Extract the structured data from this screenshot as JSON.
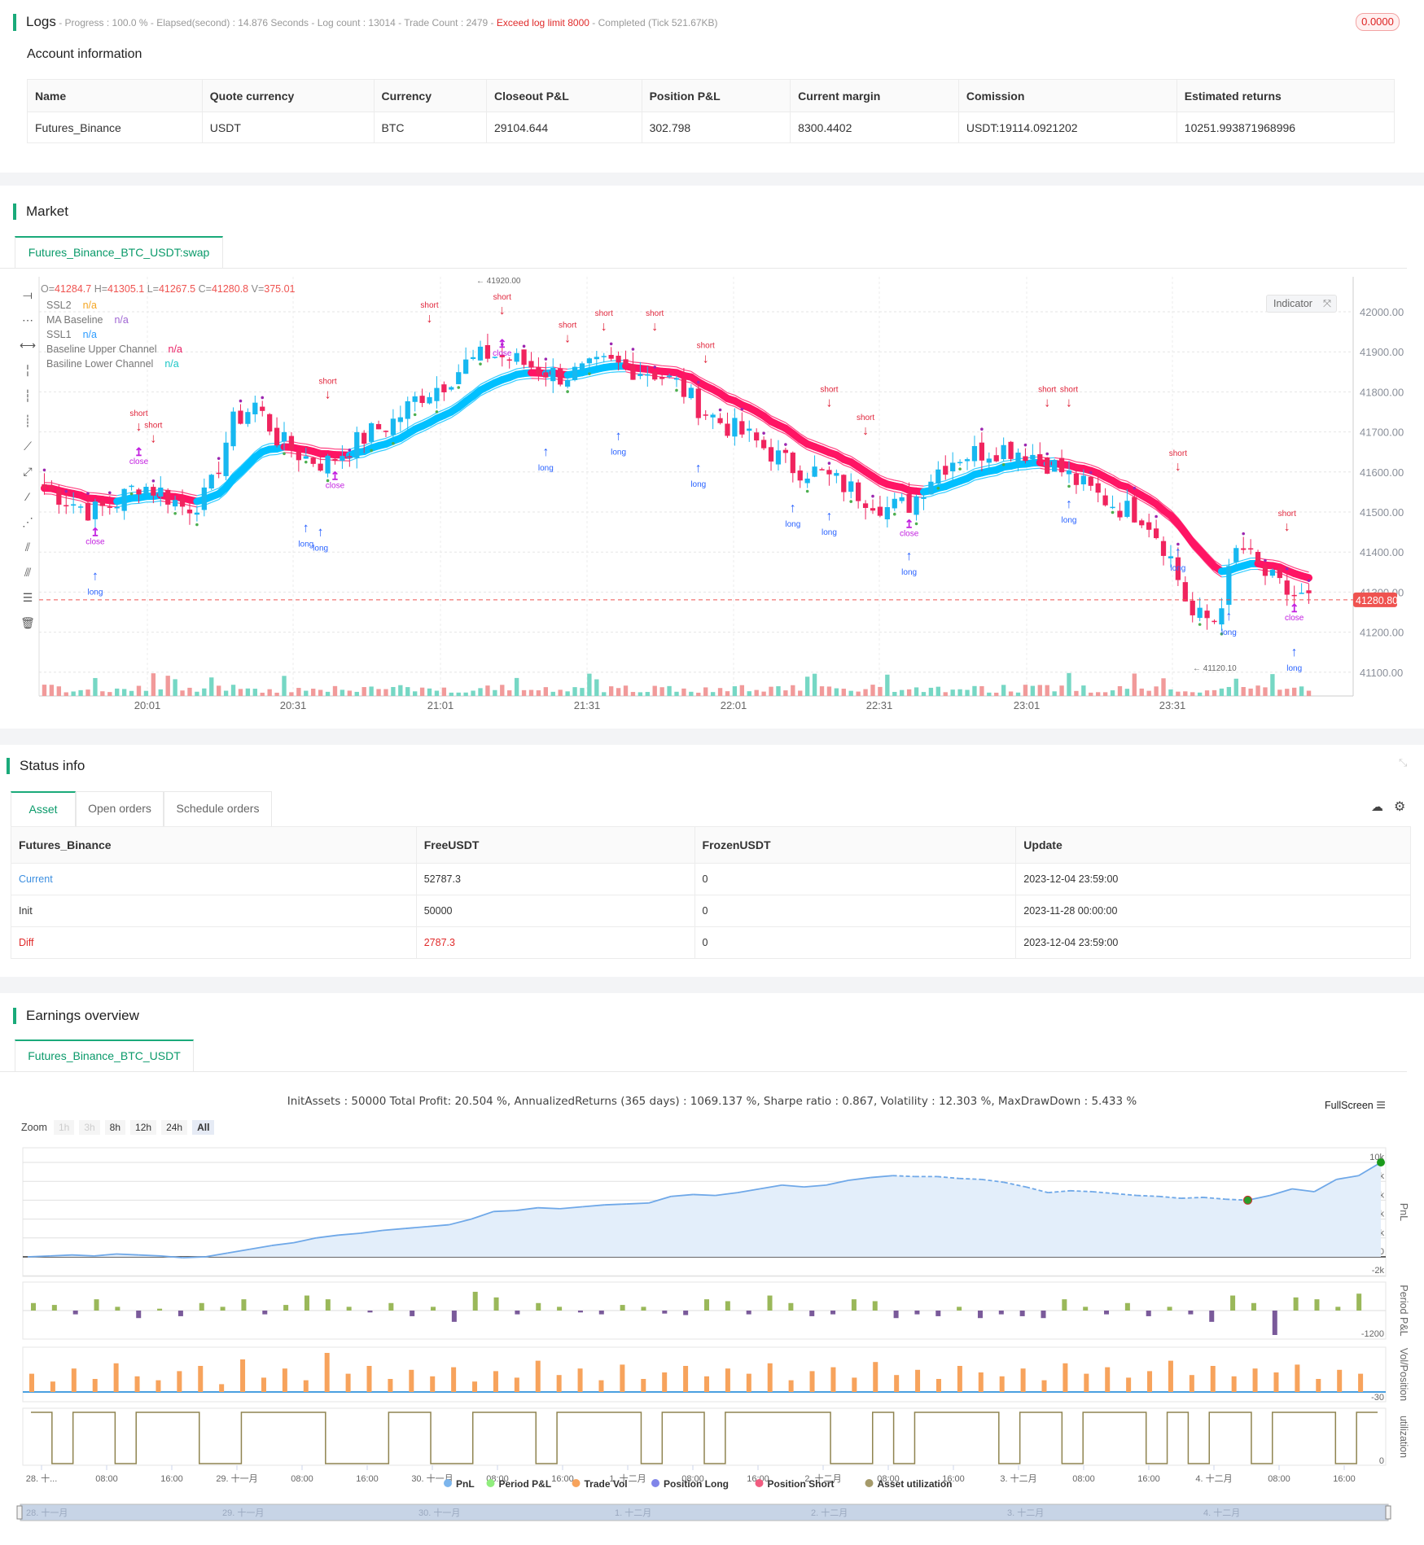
{
  "logs": {
    "title": "Logs",
    "status_prefix": " - Progress : 100.0 % - Elapsed(second) : 14.876 Seconds - Log count : 13014 - Trade Count : 2479 - ",
    "status_warning": "Exceed log limit 8000",
    "status_suffix": " - Completed (Tick 521.67KB)",
    "badge": "0.0000"
  },
  "account": {
    "title": "Account information",
    "columns": [
      "Name",
      "Quote currency",
      "Currency",
      "Closeout P&L",
      "Position P&L",
      "Current margin",
      "Comission",
      "Estimated returns"
    ],
    "row": [
      "Futures_Binance",
      "USDT",
      "BTC",
      "29104.644",
      "302.798",
      "8300.4402",
      "USDT:19114.0921202",
      "10251.993871968996"
    ]
  },
  "market": {
    "title": "Market",
    "tab": "Futures_Binance_BTC_USDT:swap",
    "ohlc": {
      "o_label": "O=",
      "o": "41284.7",
      "h_label": " H=",
      "h": "41305.1",
      "l_label": " L=",
      "l": "41267.5",
      "c_label": " C=",
      "c": "41280.8",
      "v_label": " V=",
      "v": "375.01"
    },
    "legend": [
      {
        "name": "SSL2",
        "value": "n/a",
        "color": "#f5a623"
      },
      {
        "name": "MA Baseline",
        "value": "n/a",
        "color": "#a066d3"
      },
      {
        "name": "SSL1",
        "value": "n/a",
        "color": "#2d9cff"
      },
      {
        "name": "Baseline Upper Channel",
        "value": "n/a",
        "color": "#e91e63"
      },
      {
        "name": "Basiline Lower Channel",
        "value": "n/a",
        "color": "#1cc6c6"
      }
    ],
    "indicator_button": "Indicator",
    "last_price": "41280.80",
    "last_price_value": 41280.8,
    "price_ticks": [
      42000,
      41900,
      41800,
      41700,
      41600,
      41500,
      41400,
      41300,
      41200,
      41100
    ],
    "price_tick_labels": [
      "42000.00",
      "41900.00",
      "41800.00",
      "41700.00",
      "41600.00",
      "41500.00",
      "41400.00",
      "41300.00",
      "41200.00",
      "41100.00"
    ],
    "time_labels": [
      "20:01",
      "20:31",
      "21:01",
      "21:31",
      "22:01",
      "22:31",
      "23:01",
      "23:31"
    ],
    "price_path": [
      41560,
      41530,
      41500,
      41520,
      41570,
      41550,
      41510,
      41540,
      41720,
      41770,
      41680,
      41640,
      41620,
      41660,
      41700,
      41730,
      41790,
      41820,
      41870,
      41895,
      41880,
      41860,
      41840,
      41850,
      41870,
      41860,
      41850,
      41820,
      41760,
      41720,
      41690,
      41650,
      41610,
      41600,
      41570,
      41540,
      41510,
      41520,
      41600,
      41640,
      41650,
      41660,
      41650,
      41620,
      41580,
      41540,
      41510,
      41490,
      41400,
      41240,
      41230,
      41420,
      41350,
      41300,
      41280
    ],
    "annotations": [
      {
        "t": "high",
        "label": "41920.00"
      },
      {
        "t": "low",
        "label": "41120.10"
      }
    ],
    "trades": [
      {
        "type": "long",
        "label": "long",
        "bar": 7,
        "price": 41330
      },
      {
        "type": "close",
        "label": "close",
        "bar": 7,
        "price": 41420
      },
      {
        "type": "short",
        "label": "short",
        "bar": 13,
        "price": 41740
      },
      {
        "type": "close",
        "label": "close",
        "bar": 13,
        "price": 41620
      },
      {
        "type": "short",
        "label": "short",
        "bar": 15,
        "price": 41710
      },
      {
        "type": "long",
        "label": "long",
        "bar": 36,
        "price": 41450
      },
      {
        "type": "long",
        "label": "long",
        "bar": 38,
        "price": 41440
      },
      {
        "type": "short",
        "label": "short",
        "bar": 39,
        "price": 41820
      },
      {
        "type": "close",
        "label": "close",
        "bar": 40,
        "price": 41560
      },
      {
        "type": "short",
        "label": "short",
        "bar": 53,
        "price": 42010
      },
      {
        "type": "short",
        "label": "short",
        "bar": 63,
        "price": 42030
      },
      {
        "type": "close",
        "label": "close",
        "bar": 63,
        "price": 41890
      },
      {
        "type": "long",
        "label": "long",
        "bar": 69,
        "price": 41640
      },
      {
        "type": "short",
        "label": "short",
        "bar": 72,
        "price": 41960
      },
      {
        "type": "short",
        "label": "short",
        "bar": 77,
        "price": 41990
      },
      {
        "type": "long",
        "label": "long",
        "bar": 79,
        "price": 41680
      },
      {
        "type": "short",
        "label": "short",
        "bar": 84,
        "price": 41990
      },
      {
        "type": "short",
        "label": "short",
        "bar": 91,
        "price": 41910
      },
      {
        "type": "long",
        "label": "long",
        "bar": 90,
        "price": 41600
      },
      {
        "type": "long",
        "label": "long",
        "bar": 103,
        "price": 41500
      },
      {
        "type": "short",
        "label": "short",
        "bar": 108,
        "price": 41800
      },
      {
        "type": "long",
        "label": "long",
        "bar": 108,
        "price": 41480
      },
      {
        "type": "short",
        "label": "short",
        "bar": 113,
        "price": 41730
      },
      {
        "type": "long",
        "label": "long",
        "bar": 119,
        "price": 41380
      },
      {
        "type": "close",
        "label": "close",
        "bar": 119,
        "price": 41440
      },
      {
        "type": "short",
        "label": "short",
        "bar": 138,
        "price": 41800
      },
      {
        "type": "short",
        "label": "short",
        "bar": 141,
        "price": 41800
      },
      {
        "type": "long",
        "label": "long",
        "bar": 141,
        "price": 41510
      },
      {
        "type": "short",
        "label": "short",
        "bar": 156,
        "price": 41640
      },
      {
        "type": "long",
        "label": "long",
        "bar": 156,
        "price": 41390
      },
      {
        "type": "long",
        "label": "long",
        "bar": 163,
        "price": 41230
      },
      {
        "type": "short",
        "label": "short",
        "bar": 171,
        "price": 41490
      },
      {
        "type": "long",
        "label": "long",
        "bar": 172,
        "price": 41140
      },
      {
        "type": "close",
        "label": "close",
        "bar": 172,
        "price": 41230
      }
    ],
    "colors": {
      "up": "#17b8f0",
      "down": "#f0245e",
      "ssl_up": "#00c0ff",
      "ssl_down": "#ff1464",
      "long": "#2962ff",
      "short": "#e0263c",
      "close": "#c21fe0"
    }
  },
  "status": {
    "title": "Status info",
    "tabs": [
      "Asset",
      "Open orders",
      "Schedule orders"
    ],
    "columns": [
      "Futures_Binance",
      "FreeUSDT",
      "FrozenUSDT",
      "Update"
    ],
    "rows": [
      [
        "Current",
        "52787.3",
        "0",
        "2023-12-04 23:59:00"
      ],
      [
        "Init",
        "50000",
        "0",
        "2023-11-28 00:00:00"
      ],
      [
        "Diff",
        "2787.3",
        "0",
        "2023-12-04 23:59:00"
      ]
    ]
  },
  "earnings": {
    "title": "Earnings overview",
    "tab": "Futures_Binance_BTC_USDT",
    "summary": "InitAssets : 50000 Total Profit: 20.504 %, AnnualizedReturns (365 days) : 1069.137 %, Sharpe ratio : 0.867, Volatility : 12.303 %, MaxDrawDown : 5.433 %",
    "fullscreen": "FullScreen",
    "zoom_label": "Zoom",
    "zoom_options": [
      "1h",
      "3h",
      "8h",
      "12h",
      "24h",
      "All"
    ],
    "zoom_selected": "All",
    "pnl_ticks": [
      "10k",
      "8k",
      "6k",
      "4k",
      "2k",
      "0",
      "-2k"
    ],
    "panel_labels": [
      "PnL",
      "Period P&L",
      "Vol/Position",
      "utilization"
    ],
    "period_min_label": "-1200",
    "vol_min_label": "-30",
    "util_min_label": "0",
    "x_labels": [
      "28. 十...",
      "08:00",
      "16:00",
      "29. 十一月",
      "08:00",
      "16:00",
      "30. 十一月",
      "08:00",
      "16:00",
      "1. 十二月",
      "08:00",
      "16:00",
      "2. 十二月",
      "08:00",
      "16:00",
      "3. 十二月",
      "08:00",
      "16:00",
      "4. 十二月",
      "08:00",
      "16:00"
    ],
    "legend": [
      {
        "name": "PnL",
        "color": "#7cb5ec"
      },
      {
        "name": "Period P&L",
        "color": "#90ed7d"
      },
      {
        "name": "Trade Vol",
        "color": "#f7a35c"
      },
      {
        "name": "Position Long",
        "color": "#8085e9"
      },
      {
        "name": "Position Short",
        "color": "#f15c80"
      },
      {
        "name": "Asset utilization",
        "color": "#a59a6a"
      }
    ],
    "navigator_labels": [
      "28. 十一月",
      "29. 十一月",
      "30. 十一月",
      "1. 十二月",
      "2. 十二月",
      "3. 十二月",
      "4. 十二月"
    ],
    "chart_data": {
      "type": "line",
      "ylabel": "PnL",
      "ylim": [
        -2000,
        10000
      ],
      "pnl": [
        0,
        100,
        200,
        100,
        300,
        200,
        100,
        -100,
        0,
        400,
        800,
        1200,
        1500,
        2000,
        2300,
        2500,
        2800,
        3000,
        3200,
        3400,
        4000,
        4800,
        4900,
        5200,
        5100,
        5300,
        5500,
        5600,
        5700,
        6400,
        6600,
        6500,
        6800,
        7200,
        7600,
        7400,
        7600,
        8100,
        8400,
        8600,
        8500,
        8500,
        8300,
        8200,
        7900,
        7400,
        6800,
        7000,
        6900,
        6700,
        6500,
        6400,
        6200,
        6300,
        6100,
        6000,
        6500,
        7200,
        6900,
        8200,
        8600,
        10000
      ],
      "dashed_from": 39,
      "dashed_to": 55,
      "period_pnl": [
        200,
        150,
        -100,
        300,
        100,
        -200,
        50,
        -150,
        200,
        100,
        300,
        -100,
        150,
        400,
        300,
        100,
        -50,
        200,
        -150,
        100,
        -300,
        500,
        350,
        -100,
        200,
        100,
        -50,
        -100,
        150,
        100,
        -80,
        -120,
        300,
        250,
        -100,
        400,
        200,
        -150,
        -100,
        300,
        250,
        -200,
        -100,
        -150,
        100,
        -200,
        -100,
        -150,
        -200,
        300,
        100,
        -100,
        200,
        -150,
        100,
        -100,
        -300,
        400,
        200,
        -650,
        350,
        300,
        100,
        450
      ],
      "volume": [
        14,
        8,
        18,
        10,
        22,
        12,
        9,
        16,
        20,
        6,
        25,
        11,
        18,
        9,
        30,
        14,
        20,
        10,
        17,
        12,
        19,
        8,
        16,
        11,
        24,
        13,
        18,
        9,
        21,
        10,
        15,
        20,
        12,
        18,
        14,
        22,
        9,
        16,
        19,
        11,
        23,
        13,
        17,
        10,
        20,
        15,
        12,
        18,
        9,
        22,
        14,
        19,
        11,
        16,
        24,
        13,
        20,
        12,
        18,
        15,
        21,
        10,
        17,
        14
      ],
      "utilization": [
        1,
        0,
        1,
        1,
        0,
        1,
        1,
        1,
        0,
        0,
        1,
        1,
        1,
        1,
        0,
        0,
        0,
        1,
        1,
        0,
        0,
        1,
        1,
        1,
        0,
        1,
        1,
        1,
        1,
        0,
        1,
        1,
        0,
        1,
        1,
        1,
        1,
        1,
        0,
        0,
        1,
        0,
        1,
        1,
        1,
        1,
        0,
        1,
        1,
        0,
        1,
        1,
        1,
        0,
        1,
        0,
        1,
        1,
        0,
        1,
        1,
        1,
        0,
        1
      ]
    }
  }
}
